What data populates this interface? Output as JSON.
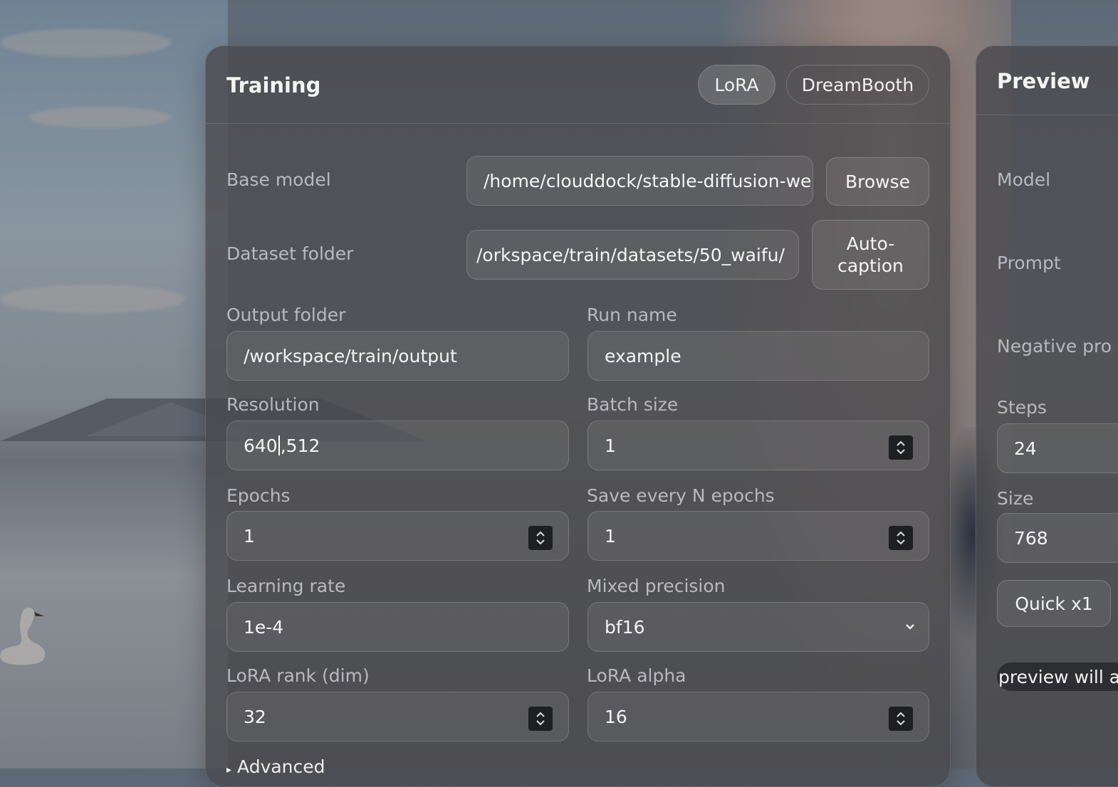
{
  "training": {
    "title": "Training",
    "modes": [
      {
        "label": "LoRA",
        "active": true
      },
      {
        "label": "DreamBooth",
        "active": false
      }
    ],
    "base_model": {
      "label": "Base model",
      "value": "/home/clouddock/stable-diffusion-we",
      "button": "Browse"
    },
    "dataset_folder": {
      "label": "Dataset folder",
      "value": "/orkspace/train/datasets/50_waifu/",
      "button_line1": "Auto-",
      "button_line2": "caption"
    },
    "output_folder": {
      "label": "Output folder",
      "value": "/workspace/train/output"
    },
    "run_name": {
      "label": "Run name",
      "value": "example"
    },
    "resolution": {
      "label": "Resolution",
      "value_before_caret": "640",
      "value_after_caret": ",512"
    },
    "batch_size": {
      "label": "Batch size",
      "value": "1"
    },
    "epochs": {
      "label": "Epochs",
      "value": "1"
    },
    "save_every": {
      "label": "Save every N epochs",
      "value": "1"
    },
    "learning_rate": {
      "label": "Learning rate",
      "value": "1e-4"
    },
    "mixed_precision": {
      "label": "Mixed precision",
      "value": "bf16"
    },
    "lora_rank": {
      "label": "LoRA rank (dim)",
      "value": "32"
    },
    "lora_alpha": {
      "label": "LoRA alpha",
      "value": "16"
    },
    "advanced": {
      "label": "Advanced"
    }
  },
  "preview": {
    "title": "Preview",
    "model_label": "Model",
    "prompt_label": "Prompt",
    "negative_label": "Negative pro",
    "steps": {
      "label": "Steps",
      "value": "24"
    },
    "size": {
      "label": "Size",
      "value": "768"
    },
    "quick_button": "Quick x1",
    "note": "preview will a"
  },
  "colors": {
    "panel_bg": "#48484c",
    "stepper_bg": "#1e1f23",
    "label_text": "#b8b9bf"
  }
}
